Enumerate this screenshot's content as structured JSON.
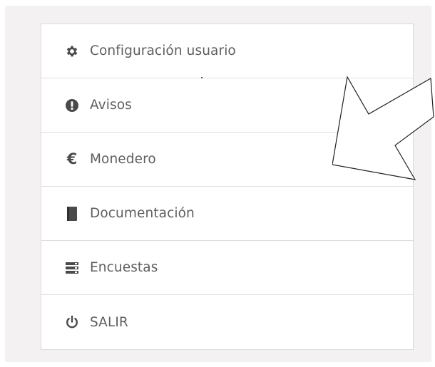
{
  "menu": {
    "items": [
      {
        "label": "Configuración usuario",
        "icon": "gear-icon"
      },
      {
        "label": "Avisos",
        "icon": "alert-icon"
      },
      {
        "label": "Monedero",
        "icon": "euro-icon",
        "glyph": "€"
      },
      {
        "label": "Documentación",
        "icon": "book-icon"
      },
      {
        "label": "Encuestas",
        "icon": "list-icon"
      },
      {
        "label": "SALIR",
        "icon": "power-icon"
      }
    ]
  },
  "colors": {
    "panel_bg": "#f3f1f1",
    "text": "#5e5e5e",
    "icon": "#4a4a4a",
    "arrow": "#222222"
  }
}
